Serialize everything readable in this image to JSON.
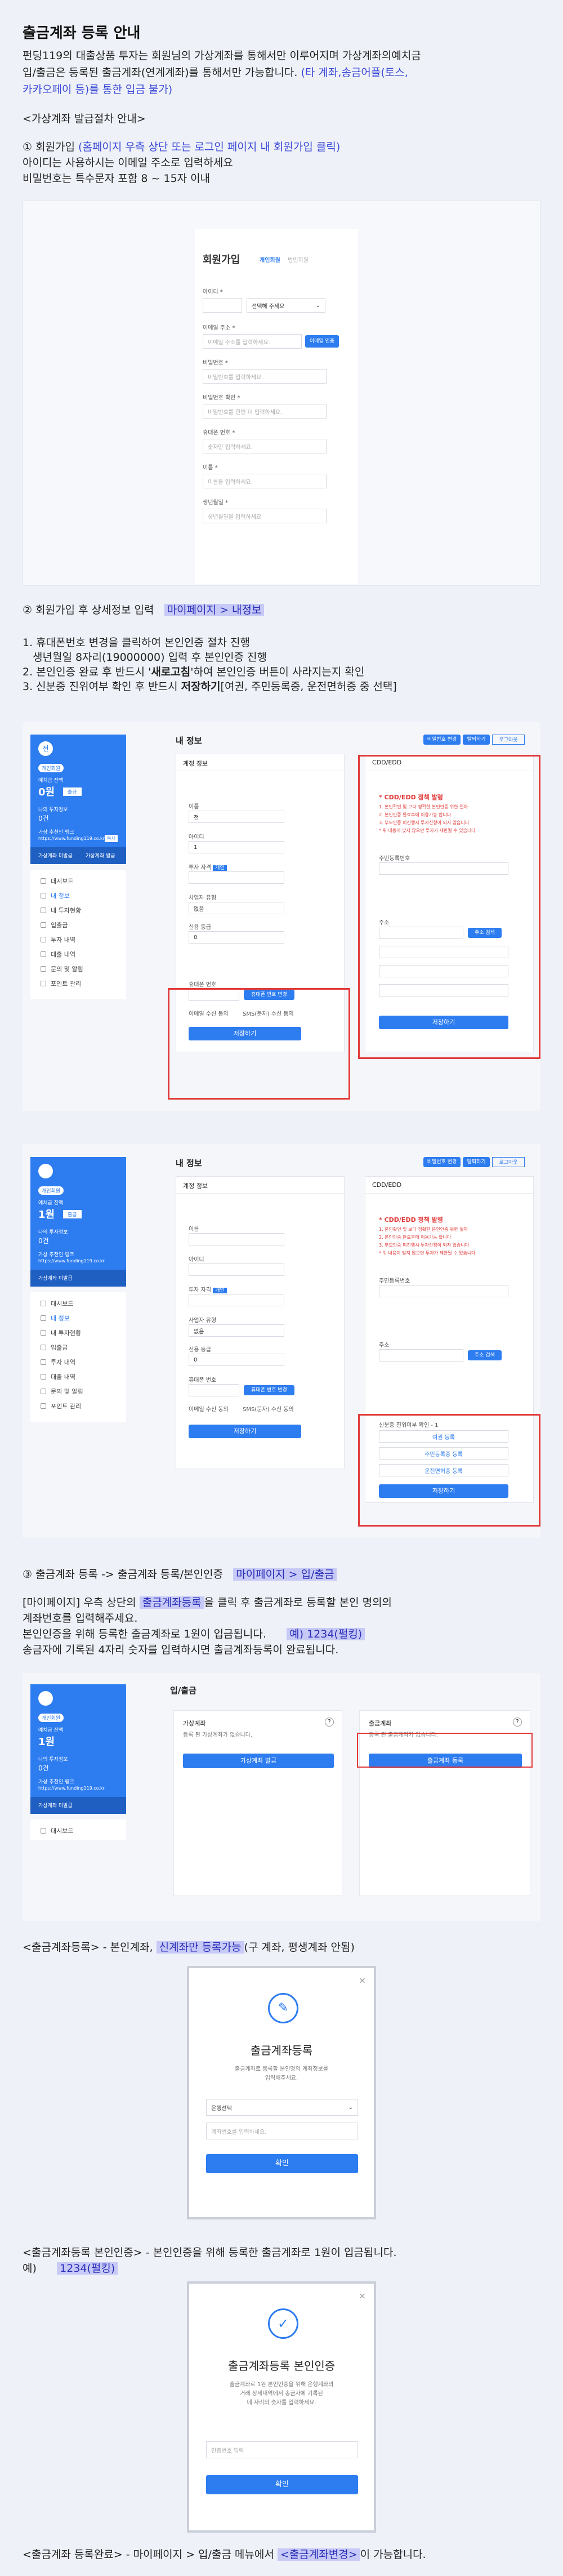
{
  "title": "출금계좌 등록 안내",
  "intro": {
    "line1": "펀딩119의 대출상품 투자는 회원님의 가상계좌를 통해서만 이루어지며 가상계좌의예치금",
    "line2a": "입/출금은 등록된 출금계좌(연계계좌)를 통해서만 가능합니다.",
    "line2b": "(타 계좌,송금어플(토스,",
    "line3": "카카오페이 등)를 통한 입금 불가)"
  },
  "proc_heading": "<가상계좌 발급절차 안내>",
  "step1": {
    "a": "① 회원가입",
    "b": "(홈페이지 우측 상단 또는 로그인 페이지 내 회원가입 클릭)",
    "l2": "아이디는 사용하시는 이메일 주소로 입력하세요",
    "l3": "비밀번호는 특수문자 포함 8 ~ 15자 이내"
  },
  "signup": {
    "title": "회원가입",
    "tab1": "개인회원",
    "tab2": "법인회원",
    "id_label": "아이디 *",
    "domain_select": "선택해 주세요",
    "email_label": "이메일 주소 *",
    "email_ph": "이메일 주소를 입력하세요.",
    "email_btn": "이메일 인증",
    "pw_label": "비밀번호 *",
    "pw_ph": "비밀번호를 입력하세요.",
    "pw2_label": "비밀번호 확인 *",
    "pw2_ph": "비밀번호를 한번 더 입력하세요.",
    "phone_label": "휴대폰 번호 *",
    "phone_ph": "숫자만 입력하세요.",
    "name_label": "이름 *",
    "name_ph": "이름을 입력하세요.",
    "birth_label": "생년월일 *",
    "birth_ph": "생년월일을 입력하세요"
  },
  "step2": {
    "a": "② 회원가입 후 상세정보 입력",
    "b": "마이페이지 > 내정보",
    "l1": "1. 휴대폰번호 변경을 클릭하여 본인인증 절차 진행",
    "l2": "생년월일 8자리(19000000) 입력 후 본인인증 진행",
    "l3a": "2. 본인인증 완료 후 반드시 '",
    "l3b": "새로고침",
    "l3c": "'하여 본인인증 버튼이 사라지는지 확인",
    "l4a": "3. 신분증 진위여부 확인 후 반드시 ",
    "l4b": "저장하기",
    "l4c": "[여권, 주민등록증, 운전면허증 중 선택]"
  },
  "mypage": {
    "section_title": "내 정보",
    "account_info": "계정 정보",
    "cdd_title": "CDD/EDD",
    "name_label": "이름",
    "name_val": "전",
    "id_label": "아이디",
    "id_val": "1",
    "type_label": "투자 자격",
    "type_badge": "개인",
    "biz_label": "사업자 유형",
    "biz_val": "없음",
    "grade_label": "신용 등급",
    "grade_val": "0",
    "phone_label": "휴대폰 번호",
    "phone_btn": "휴대폰 번호 변경",
    "sms_opt1": "이메일 수신 동의",
    "sms_opt2": "SMS(문자) 수신 동의",
    "save_btn": "저장하기",
    "top_btn1": "비밀번호 변경",
    "top_btn2": "탈퇴하기",
    "top_btn3": "로그아웃",
    "cdd_warn": "* CDD/EDD 정책 발령",
    "cdd_lines": [
      "1. 본인확인 및 보다 정확한 본인인증 위한 절차",
      "2. 본인인증 완료후에 이용가능 합니다",
      "3. 부모인증 미진행시 투자신청이 되지 않습니다",
      "* 위 내용이 맞지 않으면 투자가 제한될 수 있습니다"
    ],
    "addr_label": "주소",
    "addr_btn": "주소 검색",
    "job_label": "주민등록번호",
    "cdd_save": "저장하기",
    "id_check_title": "신분증 진위여부 확인 - 1",
    "id_opt1": "여권 등록",
    "id_opt2": "주민등록증 등록",
    "id_opt3": "운전면허증 등록"
  },
  "sidebar": {
    "avatar": "전",
    "badge": "개인회원",
    "balance_label": "예치금 잔액",
    "balance": "0원",
    "balance_btn": "출금",
    "invest_label": "나의 투자정보",
    "invest_count": "0건",
    "link_label": "가상 추천인 링크",
    "link": "https://www.funding119.co.kr",
    "link_btn": "복사",
    "vacct": "가상계좌 미발급",
    "vacct_btn": "가상계좌 발급",
    "items": [
      "대시보드",
      "내 정보",
      "내 투자현황",
      "입출금",
      "투자 내역",
      "대출 내역",
      "문의 및 알림",
      "포인트 관리"
    ]
  },
  "sidebar2": {
    "balance": "1원",
    "invest_count": "0건"
  },
  "step3": {
    "a": "③ 출금계좌 등록 -> 출금계좌 등록/본인인증",
    "b": "마이페이지 > 입/출금",
    "l1a": "[마이페이지] 우측 상단의 ",
    "l1b": "출금계좌등록",
    "l1c": "을 클릭 후 출금계좌로 등록할 본인 명의의",
    "l2": "계좌번호를 입력해주세요.",
    "l3": "본인인증을 위해 등록한 출금계좌로 1원이 입금됩니다.",
    "l3ex": "예) 1234(펄킹)",
    "l4": "송금자에 기록된 4자리 숫자를 입력하시면 출금계좌등록이 완료됩니다."
  },
  "inout": {
    "title": "입/출금",
    "vacct_title": "가상계좌",
    "vacct_desc": "등록 된 가상계좌가 없습니다.",
    "vacct_btn": "가상계좌 발급",
    "wd_title": "출금계좌",
    "wd_desc": "등록 된 출금계좌가 없습니다.",
    "wd_btn": "출금계좌 등록",
    "side_item": "대시보드"
  },
  "reg_caption": {
    "a": "<출금계좌등록> - 본인계좌, ",
    "b": "신계좌만 등록가능",
    "c": "(구 계좌, 평생계좌 안됨)"
  },
  "modal1": {
    "title": "출금계좌등록",
    "desc1": "출금계좌로 등록할 본인명의 계좌정보를",
    "desc2": "입력해주세요.",
    "bank": "은행선택",
    "acct_ph": "계좌번호를 입력하세요.",
    "ok": "확인"
  },
  "auth_caption": {
    "a": "<출금계좌등록 본인인증> - 본인인증을 위해 등록한 출금계좌로 1원이 입금됩니다.",
    "ex_a": "예)",
    "ex_b": "1234(펄킹)"
  },
  "modal2": {
    "title": "출금계좌등록 본인인증",
    "desc1": "출금계좌로 1원 본인인증을 위해 은행계좌의",
    "desc2": "거래 상세내역에서 송금자에 기록된",
    "desc3": "네 자리의 숫자를 입력하세요.",
    "ph": "인증번호 입력",
    "ok": "확인"
  },
  "done_caption": {
    "a": "<출금계좌 등록완료> - 마이페이지 > 입/출금 메뉴에서 ",
    "b": "<출금계좌변경>",
    "c": "이 가능합니다."
  },
  "colors": {
    "accent": "#2d7cf0",
    "highlight": "#c7c9f7",
    "red": "#e23a3a"
  }
}
